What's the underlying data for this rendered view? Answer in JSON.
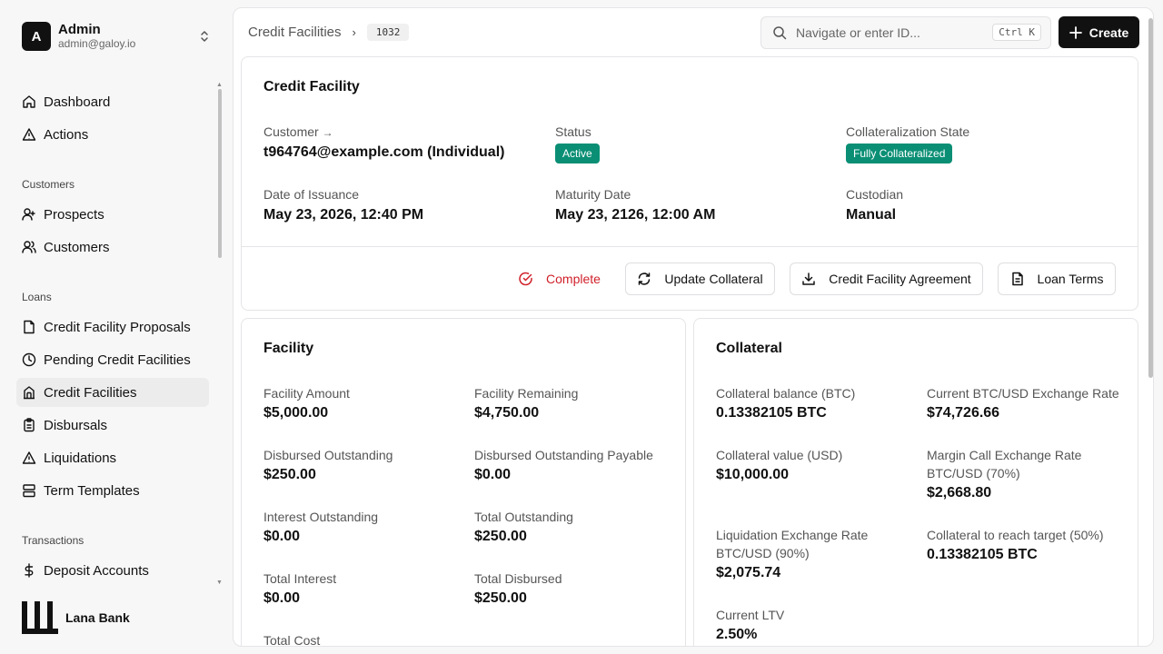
{
  "user": {
    "initial": "A",
    "name": "Admin",
    "email": "admin@galoy.io"
  },
  "nav": {
    "main": [
      {
        "label": "Dashboard",
        "icon": "home-icon"
      },
      {
        "label": "Actions",
        "icon": "alert-triangle-icon"
      }
    ],
    "customers_section": "Customers",
    "customers": [
      {
        "label": "Prospects",
        "icon": "user-plus-icon"
      },
      {
        "label": "Customers",
        "icon": "users-icon"
      }
    ],
    "loans_section": "Loans",
    "loans": [
      {
        "label": "Credit Facility Proposals",
        "icon": "file-icon"
      },
      {
        "label": "Pending Credit Facilities",
        "icon": "clock-icon"
      },
      {
        "label": "Credit Facilities",
        "icon": "building-icon",
        "active": true
      },
      {
        "label": "Disbursals",
        "icon": "clipboard-icon"
      },
      {
        "label": "Liquidations",
        "icon": "alert-triangle-icon"
      },
      {
        "label": "Term Templates",
        "icon": "layout-icon"
      }
    ],
    "transactions_section": "Transactions",
    "transactions": [
      {
        "label": "Deposit Accounts",
        "icon": "dollar-icon"
      }
    ]
  },
  "brand": {
    "name": "Lana Bank"
  },
  "breadcrumb": {
    "parent": "Credit Facilities",
    "id": "1032"
  },
  "search": {
    "placeholder": "Navigate or enter ID...",
    "shortcut": "Ctrl K"
  },
  "create_label": "Create",
  "credit_facility": {
    "title": "Credit Facility",
    "customer_label": "Customer",
    "customer_value": "t964764@example.com (Individual)",
    "status_label": "Status",
    "status_value": "Active",
    "collat_state_label": "Collateralization State",
    "collat_state_value": "Fully Collateralized",
    "issuance_label": "Date of Issuance",
    "issuance_value": "May 23, 2026, 12:40 PM",
    "maturity_label": "Maturity Date",
    "maturity_value": "May 23, 2126, 12:00 AM",
    "custodian_label": "Custodian",
    "custodian_value": "Manual",
    "actions": {
      "complete": "Complete",
      "update_collateral": "Update Collateral",
      "agreement": "Credit Facility Agreement",
      "loan_terms": "Loan Terms"
    }
  },
  "facility": {
    "title": "Facility",
    "fields": [
      {
        "label": "Facility Amount",
        "value": "$5,000.00"
      },
      {
        "label": "Facility Remaining",
        "value": "$4,750.00"
      },
      {
        "label": "Disbursed Outstanding",
        "value": "$250.00"
      },
      {
        "label": "Disbursed Outstanding Payable",
        "value": "$0.00"
      },
      {
        "label": "Interest Outstanding",
        "value": "$0.00"
      },
      {
        "label": "Total Outstanding",
        "value": "$250.00"
      },
      {
        "label": "Total Interest",
        "value": "$0.00"
      },
      {
        "label": "Total Disbursed",
        "value": "$250.00"
      },
      {
        "label": "Total Cost",
        "value": ""
      }
    ]
  },
  "collateral": {
    "title": "Collateral",
    "fields": [
      {
        "label": "Collateral balance (BTC)",
        "value": "0.13382105 BTC"
      },
      {
        "label": "Current BTC/USD Exchange Rate",
        "value": "$74,726.66"
      },
      {
        "label": "Collateral value (USD)",
        "value": "$10,000.00"
      },
      {
        "label": "Margin Call Exchange Rate",
        "label2": "BTC/USD (70%)",
        "value": "$2,668.80"
      },
      {
        "label": "Liquidation Exchange Rate",
        "label2": "BTC/USD (90%)",
        "value": "$2,075.74"
      },
      {
        "label": "Collateral to reach target (50%)",
        "value": "0.13382105 BTC"
      },
      {
        "label": "Current LTV",
        "value": "2.50%"
      }
    ]
  }
}
